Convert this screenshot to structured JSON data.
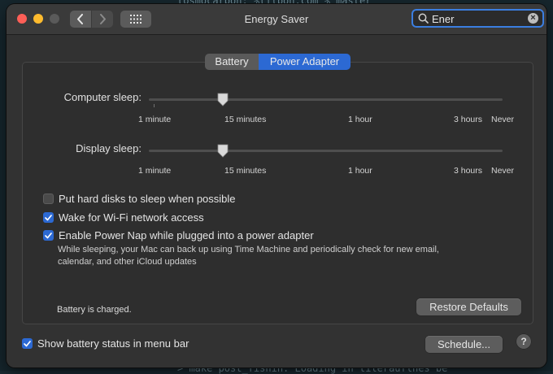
{
  "background": {
    "code_lines": [
      "tosmocarbon: %tilbon.com % master",
      "> make post_fishin: Loading in tilerauflnes be"
    ]
  },
  "window": {
    "title": "Energy Saver",
    "search": {
      "value": "Ener",
      "placeholder": "Search"
    }
  },
  "tabs": [
    {
      "label": "Battery",
      "selected": false
    },
    {
      "label": "Power Adapter",
      "selected": true
    }
  ],
  "sliders": [
    {
      "label": "Computer sleep:",
      "value": "15 minutes",
      "ticks": [
        "1 minute",
        "15 minutes",
        "1 hour",
        "3 hours",
        "Never"
      ]
    },
    {
      "label": "Display sleep:",
      "value": "15 minutes",
      "ticks": [
        "1 minute",
        "15 minutes",
        "1 hour",
        "3 hours",
        "Never"
      ]
    }
  ],
  "options": [
    {
      "label": "Put hard disks to sleep when possible",
      "checked": false
    },
    {
      "label": "Wake for Wi-Fi network access",
      "checked": true
    },
    {
      "label": "Enable Power Nap while plugged into a power adapter",
      "checked": true,
      "description_line1": "While sleeping, your Mac can back up using Time Machine and periodically check for new email,",
      "description_line2": "calendar, and other iCloud updates"
    }
  ],
  "status_text": "Battery is charged.",
  "buttons": {
    "restore_defaults": "Restore Defaults",
    "schedule": "Schedule...",
    "help": "?"
  },
  "show_battery_status": {
    "label": "Show battery status in menu bar",
    "checked": true
  },
  "colors": {
    "accent": "#2c69d3",
    "search_focus": "#3b7ee0",
    "close": "#fe5f57",
    "minimize": "#febb2e"
  },
  "icons": [
    "chevron-left-icon",
    "chevron-right-icon",
    "grid-icon",
    "search-icon",
    "clear-icon",
    "slider-knob-icon",
    "checkmark-icon"
  ]
}
